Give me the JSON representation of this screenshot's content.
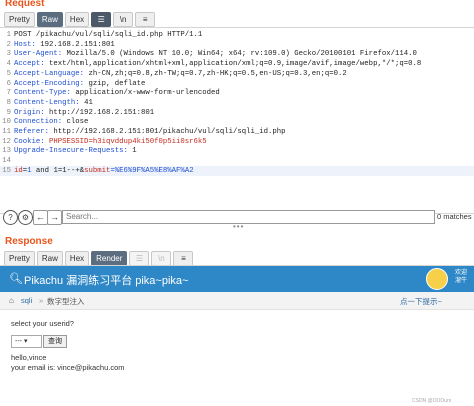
{
  "request": {
    "title": "Request",
    "tabs": [
      "Pretty",
      "Raw",
      "Hex"
    ],
    "active_tab": "Raw",
    "icon_newline": "\\n",
    "lines": [
      {
        "n": "1",
        "parts": [
          {
            "t": "POST /pikachu/vul/sqli/sqli_id.php HTTP/1.1",
            "c": "hv"
          }
        ]
      },
      {
        "n": "2",
        "parts": [
          {
            "t": "Host: ",
            "c": "hk"
          },
          {
            "t": "192.168.2.151:801",
            "c": "hv"
          }
        ]
      },
      {
        "n": "3",
        "parts": [
          {
            "t": "User-Agent: ",
            "c": "hk"
          },
          {
            "t": "Mozilla/5.0 (Windows NT 10.0; Win64; x64; rv:109.0) Gecko/20100101 Firefox/114.0",
            "c": "hv"
          }
        ]
      },
      {
        "n": "4",
        "parts": [
          {
            "t": "Accept: ",
            "c": "hk"
          },
          {
            "t": "text/html,application/xhtml+xml,application/xml;q=0.9,image/avif,image/webp,*/*;q=0.8",
            "c": "hv"
          }
        ]
      },
      {
        "n": "5",
        "parts": [
          {
            "t": "Accept-Language: ",
            "c": "hk"
          },
          {
            "t": "zh-CN,zh;q=0.8,zh-TW;q=0.7,zh-HK;q=0.5,en-US;q=0.3,en;q=0.2",
            "c": "hv"
          }
        ]
      },
      {
        "n": "6",
        "parts": [
          {
            "t": "Accept-Encoding: ",
            "c": "hk"
          },
          {
            "t": "gzip, deflate",
            "c": "hv"
          }
        ]
      },
      {
        "n": "7",
        "parts": [
          {
            "t": "Content-Type: ",
            "c": "hk"
          },
          {
            "t": "application/x-www-form-urlencoded",
            "c": "hv"
          }
        ]
      },
      {
        "n": "8",
        "parts": [
          {
            "t": "Content-Length: ",
            "c": "hk"
          },
          {
            "t": "41",
            "c": "hv"
          }
        ]
      },
      {
        "n": "9",
        "parts": [
          {
            "t": "Origin: ",
            "c": "hk"
          },
          {
            "t": "http://192.168.2.151:801",
            "c": "hv"
          }
        ]
      },
      {
        "n": "10",
        "parts": [
          {
            "t": "Connection: ",
            "c": "hk"
          },
          {
            "t": "close",
            "c": "hv"
          }
        ]
      },
      {
        "n": "11",
        "parts": [
          {
            "t": "Referer: ",
            "c": "hk"
          },
          {
            "t": "http://192.168.2.151:801/pikachu/vul/sqli/sqli_id.php",
            "c": "hv"
          }
        ]
      },
      {
        "n": "12",
        "parts": [
          {
            "t": "Cookie: ",
            "c": "hk"
          },
          {
            "t": "PHPSESSID",
            "c": "ck"
          },
          {
            "t": "=h3iqvddup4ki50f0p5ii0sr6k5",
            "c": "cv"
          }
        ]
      },
      {
        "n": "13",
        "parts": [
          {
            "t": "Upgrade-Insecure-Requests: ",
            "c": "hk"
          },
          {
            "t": "1",
            "c": "hv"
          }
        ]
      },
      {
        "n": "14",
        "parts": []
      },
      {
        "n": "15",
        "parts": [
          {
            "t": "id",
            "c": "pk"
          },
          {
            "t": "=",
            "c": "pt"
          },
          {
            "t": "1",
            "c": "pv"
          },
          {
            "t": " and 1=1--+&",
            "c": "pt"
          },
          {
            "t": "submit",
            "c": "pk"
          },
          {
            "t": "=%E6%9F%A5%E8%AF%A2",
            "c": "pv"
          }
        ]
      }
    ]
  },
  "search": {
    "placeholder": "Search...",
    "matches": "0 matches"
  },
  "response": {
    "title": "Response",
    "tabs": [
      "Pretty",
      "Raw",
      "Hex",
      "Render"
    ],
    "active_tab": "Render"
  },
  "page": {
    "title": "Pikachu 漏洞练习平台 pika~pika~",
    "welcome": "欢迎\n溜牛",
    "breadcrumb_link": "sqli",
    "breadcrumb_sep": "»",
    "breadcrumb_current": "数字型注入",
    "tip_link": "点一下提示~",
    "label": "select your userid?",
    "select_value": "---",
    "query_button": "查询",
    "hello": "hello,vince",
    "email": "your email is: vince@pikachu.com",
    "watermark": "CSDN @OOOurs"
  },
  "colors": {
    "accent": "#e8541b",
    "header_blue": "#2e87c7",
    "active_tab": "#5c6d80"
  }
}
